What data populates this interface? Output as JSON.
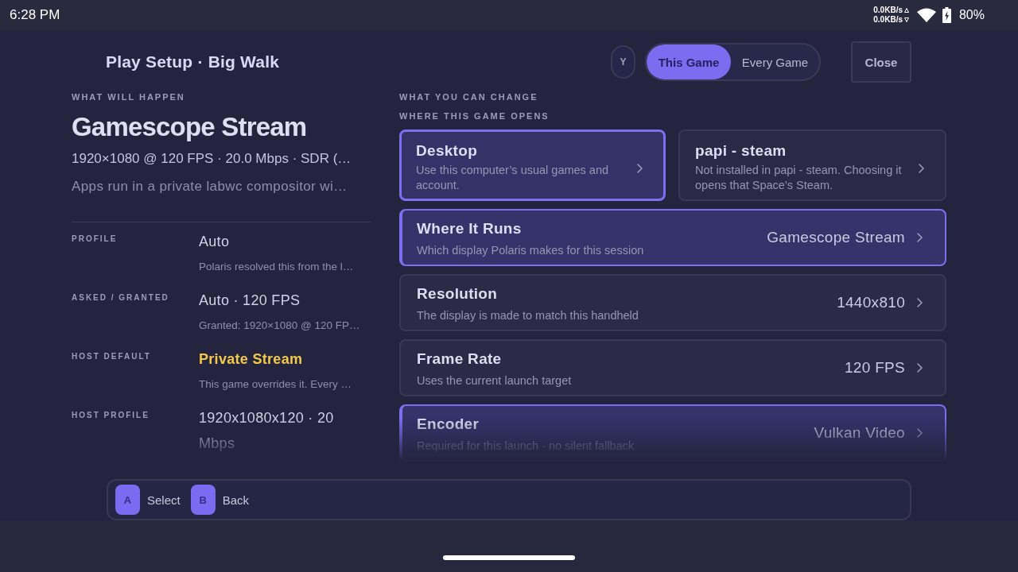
{
  "status_bar": {
    "time": "6:28 PM",
    "upload": "0.0KB/s",
    "download": "0.0KB/s",
    "battery": "80%"
  },
  "header": {
    "title": "Play Setup · Big Walk",
    "shortcut_key": "Y",
    "scope_tabs": [
      {
        "label": "This Game",
        "selected": true
      },
      {
        "label": "Every Game",
        "selected": false
      }
    ],
    "close_button": "Close"
  },
  "summary": {
    "section_label": "WHAT WILL HAPPEN",
    "title": "Gamescope Stream",
    "details": [
      "1920×1080 @ 120 FPS · 20.0 Mbps · SDR (…",
      "Apps run in a private labwc compositor wi…"
    ],
    "facts": [
      {
        "label": "PROFILE",
        "value": "Auto",
        "note": "Polaris resolved this from the l…",
        "highlighted": false
      },
      {
        "label": "ASKED / GRANTED",
        "value": "Auto · 120 FPS",
        "note": "Granted: 1920×1080 @ 120 FP…",
        "highlighted": false
      },
      {
        "label": "HOST DEFAULT",
        "value": "Private Stream",
        "note": "This game overrides it. Every …",
        "highlighted": true
      },
      {
        "label": "HOST PROFILE",
        "value": "1920x1080x120 · 20 Mbps",
        "highlighted": false
      }
    ]
  },
  "changes": {
    "section_label": "WHAT YOU CAN CHANGE",
    "group_label": "WHERE THIS GAME OPENS",
    "destinations": [
      {
        "title": "Desktop",
        "description": "Use this computer’s usual games and account.",
        "selected": true
      },
      {
        "title": "papi - steam",
        "description": "Not installed in papi - steam. Choosing it opens that Space’s Steam.",
        "selected": false
      }
    ],
    "settings": [
      {
        "title": "Where It Runs",
        "description": "Which display Polaris makes for this session",
        "value": "Gamescope Stream",
        "highlighted": true
      },
      {
        "title": "Resolution",
        "description": "The display is made to match this handheld",
        "value": "1440x810",
        "highlighted": false
      },
      {
        "title": "Frame Rate",
        "description": "Uses the current launch target",
        "value": "120 FPS",
        "highlighted": false
      },
      {
        "title": "Encoder",
        "description": "Required for this launch · no silent fallback",
        "value": "Vulkan Video",
        "highlighted": true
      }
    ]
  },
  "footer": {
    "hints": [
      {
        "key": "A",
        "label": "Select"
      },
      {
        "key": "B",
        "label": "Back"
      }
    ]
  }
}
